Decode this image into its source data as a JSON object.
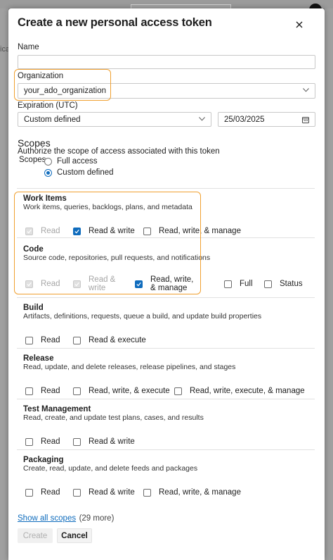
{
  "dialog": {
    "title": "Create a new personal access token",
    "name": {
      "label": "Name",
      "value": ""
    },
    "organization": {
      "label": "Organization",
      "value": "your_ado_organization"
    },
    "expiration": {
      "label": "Expiration (UTC)",
      "value": "Custom defined",
      "date": "25/03/2025"
    },
    "scopes": {
      "title": "Scopes",
      "subtitle": "Authorize the scope of access associated with this token",
      "label": "Scopes",
      "options": [
        {
          "label": "Full access",
          "selected": false
        },
        {
          "label": "Custom defined",
          "selected": true
        }
      ]
    },
    "sections": [
      {
        "title": "Work Items",
        "desc": "Work items, queries, backlogs, plans, and metadata",
        "options": [
          {
            "label": "Read",
            "checked": true,
            "disabled": true
          },
          {
            "label": "Read & write",
            "checked": true,
            "disabled": false
          },
          {
            "label": "Read, write, & manage",
            "checked": false,
            "disabled": false
          }
        ]
      },
      {
        "title": "Code",
        "desc": "Source code, repositories, pull requests, and notifications",
        "options": [
          {
            "label": "Read",
            "checked": true,
            "disabled": true
          },
          {
            "label": "Read & write",
            "checked": true,
            "disabled": true
          },
          {
            "label": "Read, write, & manage",
            "checked": true,
            "disabled": false
          },
          {
            "label": "Full",
            "checked": false,
            "disabled": false
          },
          {
            "label": "Status",
            "checked": false,
            "disabled": false
          }
        ]
      },
      {
        "title": "Build",
        "desc": "Artifacts, definitions, requests, queue a build, and update build properties",
        "options": [
          {
            "label": "Read",
            "checked": false,
            "disabled": false
          },
          {
            "label": "Read & execute",
            "checked": false,
            "disabled": false
          }
        ]
      },
      {
        "title": "Release",
        "desc": "Read, update, and delete releases, release pipelines, and stages",
        "options": [
          {
            "label": "Read",
            "checked": false,
            "disabled": false
          },
          {
            "label": "Read, write, & execute",
            "checked": false,
            "disabled": false
          },
          {
            "label": "Read, write, execute, & manage",
            "checked": false,
            "disabled": false
          }
        ]
      },
      {
        "title": "Test Management",
        "desc": "Read, create, and update test plans, cases, and results",
        "options": [
          {
            "label": "Read",
            "checked": false,
            "disabled": false
          },
          {
            "label": "Read & write",
            "checked": false,
            "disabled": false
          }
        ]
      },
      {
        "title": "Packaging",
        "desc": "Create, read, update, and delete feeds and packages",
        "options": [
          {
            "label": "Read",
            "checked": false,
            "disabled": false
          },
          {
            "label": "Read & write",
            "checked": false,
            "disabled": false
          },
          {
            "label": "Read, write, & manage",
            "checked": false,
            "disabled": false
          }
        ]
      }
    ],
    "show_all_link": "Show all scopes",
    "show_all_count": "(29 more)",
    "create_label": "Create",
    "cancel_label": "Cancel"
  },
  "background": {
    "partial_text": "ica"
  },
  "colors": {
    "accent": "#0f6cbd",
    "highlight": "#f0a030"
  }
}
